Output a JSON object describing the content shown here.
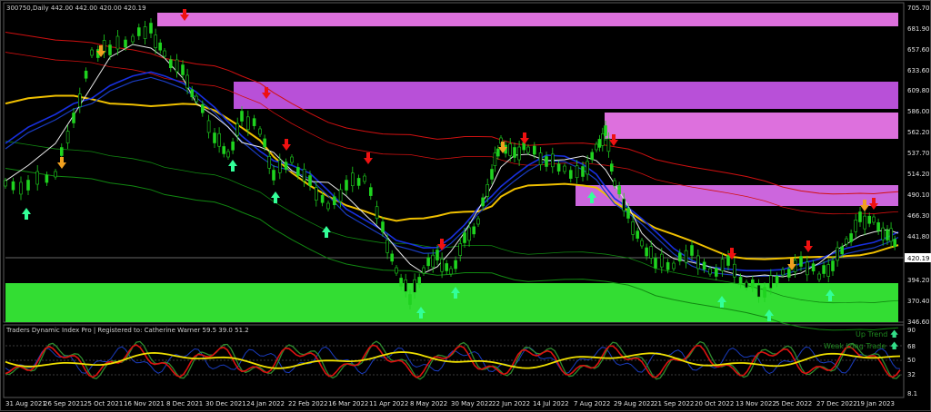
{
  "symbol_info": "300750,Daily  442.00 442.00 420.00 420.19",
  "indicator_info": "Traders Dynamic Index Pro | Registered to: Catherine Warner 59.5 39.0 51.2",
  "last_price": "420.19",
  "signals": {
    "up_trend": "Up Trend",
    "weak_long": "Weak Long Trade"
  },
  "price_axis": [
    "705.70",
    "681.90",
    "657.60",
    "633.60",
    "609.80",
    "586.00",
    "562.20",
    "537.70",
    "514.20",
    "490.10",
    "466.30",
    "441.80",
    "420.19",
    "394.20",
    "370.40",
    "346.60"
  ],
  "indicator_axis": [
    "90",
    "68",
    "50",
    "32",
    "8.1"
  ],
  "date_axis": [
    "31 Aug 2021",
    "26 Sep 2021",
    "25 Oct 2021",
    "16 Nov 2021",
    "8 Dec 2021",
    "30 Dec 2021",
    "24 Jan 2022",
    "22 Feb 2022",
    "16 Mar 2022",
    "11 Apr 2022",
    "8 May 2022",
    "30 May 2022",
    "22 Jun 2022",
    "14 Jul 2022",
    "7 Aug 2022",
    "29 Aug 2022",
    "21 Sep 2022",
    "20 Oct 2022",
    "13 Nov 2022",
    "5 Dec 2022",
    "27 Dec 2022",
    "19 Jan 2023"
  ],
  "colors": {
    "background": "#000000",
    "bullish_candle": "#1fd31f",
    "supply_zone": "#dd70dd",
    "supply_zone_dark": "#b850d8",
    "demand_zone": "#33dd33",
    "upper_band": "#d01010",
    "lower_band": "#118811",
    "ma_yellow": "#f0c000",
    "ma_blue": "#1830e0",
    "ma_white": "#e8e8e8",
    "buy_arrow": "#33ff99",
    "sell_arrow": "#ee1111",
    "ambiguous_arrow": "#f0a020"
  }
}
